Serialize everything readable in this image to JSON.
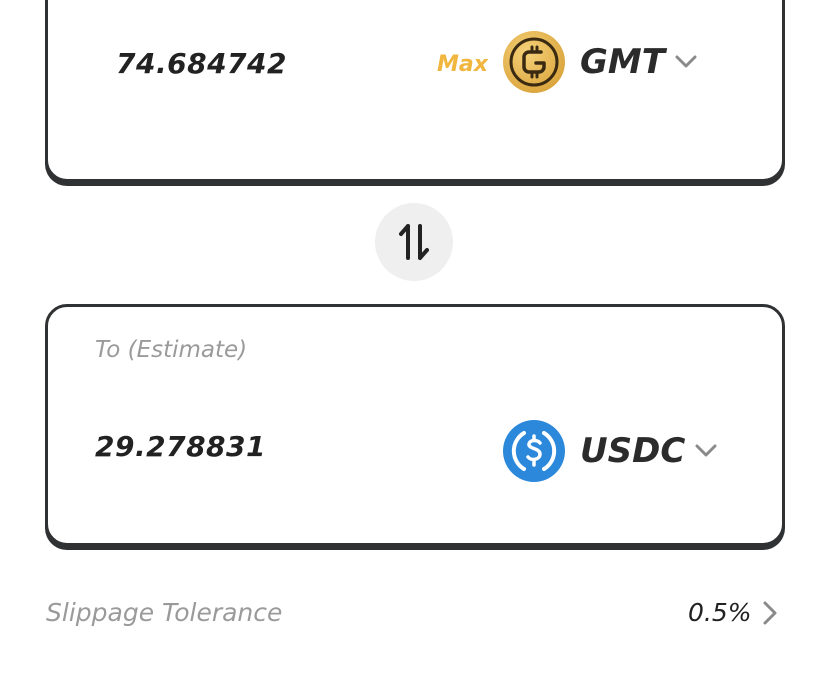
{
  "from": {
    "amount": "74.684742",
    "max_label": "Max",
    "token": {
      "symbol": "GMT",
      "icon": "gmt-coin-icon",
      "color": "#e0ac3c"
    }
  },
  "swap": {
    "icon": "swap-arrows-icon"
  },
  "to": {
    "label": "To (Estimate)",
    "amount": "29.278831",
    "token": {
      "symbol": "USDC",
      "icon": "usdc-coin-icon",
      "color": "#2b88db"
    }
  },
  "slippage": {
    "label": "Slippage Tolerance",
    "value": "0.5%"
  },
  "colors": {
    "border": "#2f3133",
    "muted_text": "#9a9a9a",
    "accent_max": "#f0b63e"
  }
}
